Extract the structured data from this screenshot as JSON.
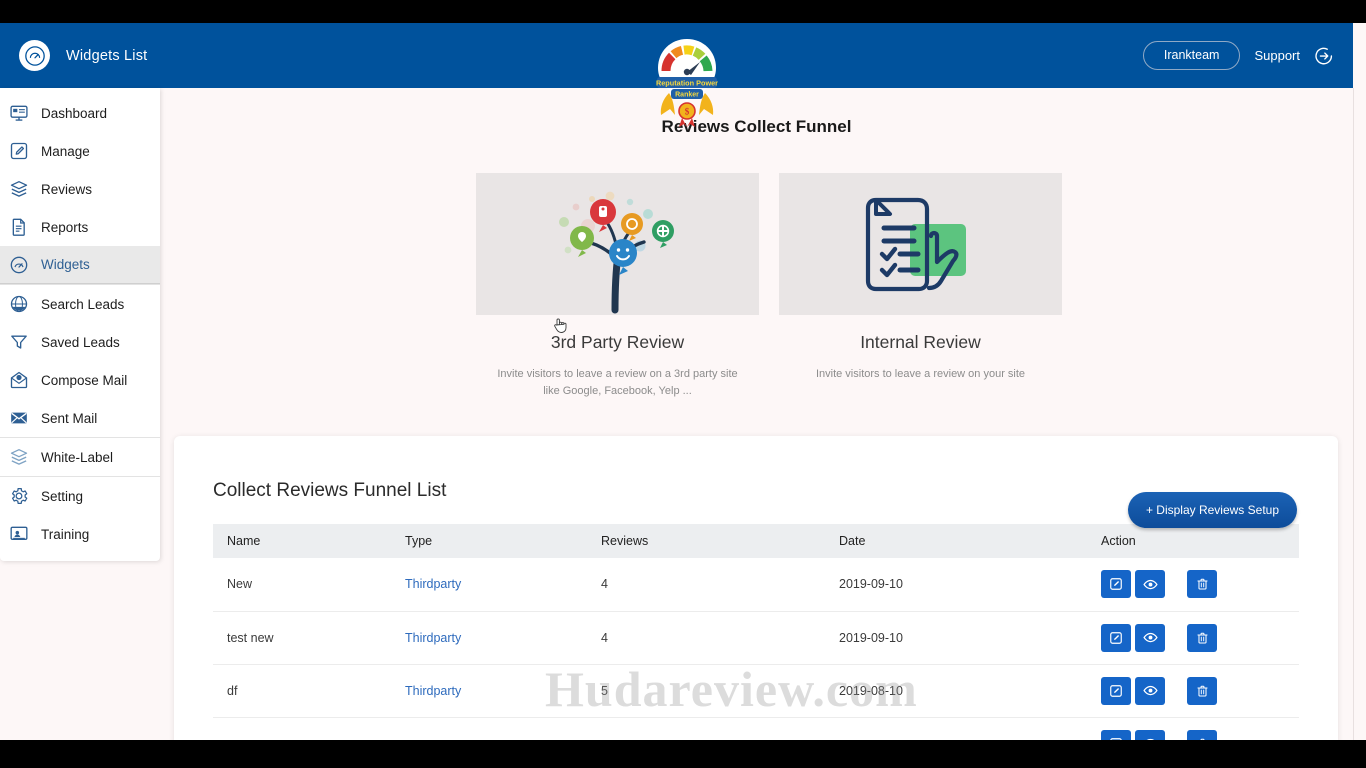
{
  "header": {
    "title": "Widgets List",
    "brand_icon": "speedometer-badge-icon",
    "user_name": "Irankteam",
    "support_label": "Support",
    "logout_icon": "logout-icon",
    "logo_alt": "Reputation Power Ranker",
    "logo_line1": "Reputation Power",
    "logo_line2": "Ranker",
    "bg_color": "#00529c"
  },
  "sidebar": {
    "groups": [
      {
        "items": [
          {
            "label": "Dashboard",
            "icon": "monitor-icon",
            "active": false
          },
          {
            "label": "Manage",
            "icon": "pencil-square-icon",
            "active": false
          },
          {
            "label": "Reviews",
            "icon": "layers-icon",
            "active": false
          },
          {
            "label": "Reports",
            "icon": "document-icon",
            "active": false
          },
          {
            "label": "Widgets",
            "icon": "gauge-icon",
            "active": true
          }
        ]
      },
      {
        "items": [
          {
            "label": "Search Leads",
            "icon": "globe-search-icon",
            "active": false
          },
          {
            "label": "Saved Leads",
            "icon": "funnel-icon",
            "active": false
          },
          {
            "label": "Compose Mail",
            "icon": "mail-open-icon",
            "active": false
          },
          {
            "label": "Sent Mail",
            "icon": "mail-sent-icon",
            "active": false
          }
        ]
      },
      {
        "items": [
          {
            "label": "White-Label",
            "icon": "layers-icon",
            "active": false
          }
        ]
      },
      {
        "items": [
          {
            "label": "Setting",
            "icon": "gear-icon",
            "active": false
          },
          {
            "label": "Training",
            "icon": "training-icon",
            "active": false
          }
        ]
      }
    ]
  },
  "funnel": {
    "section_title": "Reviews Collect Funnel",
    "cards": [
      {
        "title": "3rd Party Review",
        "description": "Invite visitors to leave a review on a 3rd party site like Google, Facebook, Yelp ...",
        "image": "review-tree-illustration"
      },
      {
        "title": "Internal Review",
        "description": "Invite visitors to leave a review on your site",
        "image": "checklist-hand-illustration"
      }
    ]
  },
  "panel": {
    "title": "Collect Reviews Funnel List",
    "setup_button": "+ Display Reviews Setup",
    "columns": [
      "Name",
      "Type",
      "Reviews",
      "Date",
      "Action"
    ],
    "rows": [
      {
        "name": "New",
        "type": "Thirdparty",
        "reviews": "4",
        "date": "2019-09-10"
      },
      {
        "name": "test new",
        "type": "Thirdparty",
        "reviews": "4",
        "date": "2019-09-10"
      },
      {
        "name": "df",
        "type": "Thirdparty",
        "reviews": "5",
        "date": "2019-08-10"
      },
      {
        "name": "",
        "type": "",
        "reviews": "",
        "date": ""
      }
    ],
    "action_icons": [
      "edit-icon",
      "eye-icon",
      "trash-icon"
    ],
    "accent_color": "#1565c8"
  },
  "watermark": {
    "text": "Hudareview.com"
  }
}
